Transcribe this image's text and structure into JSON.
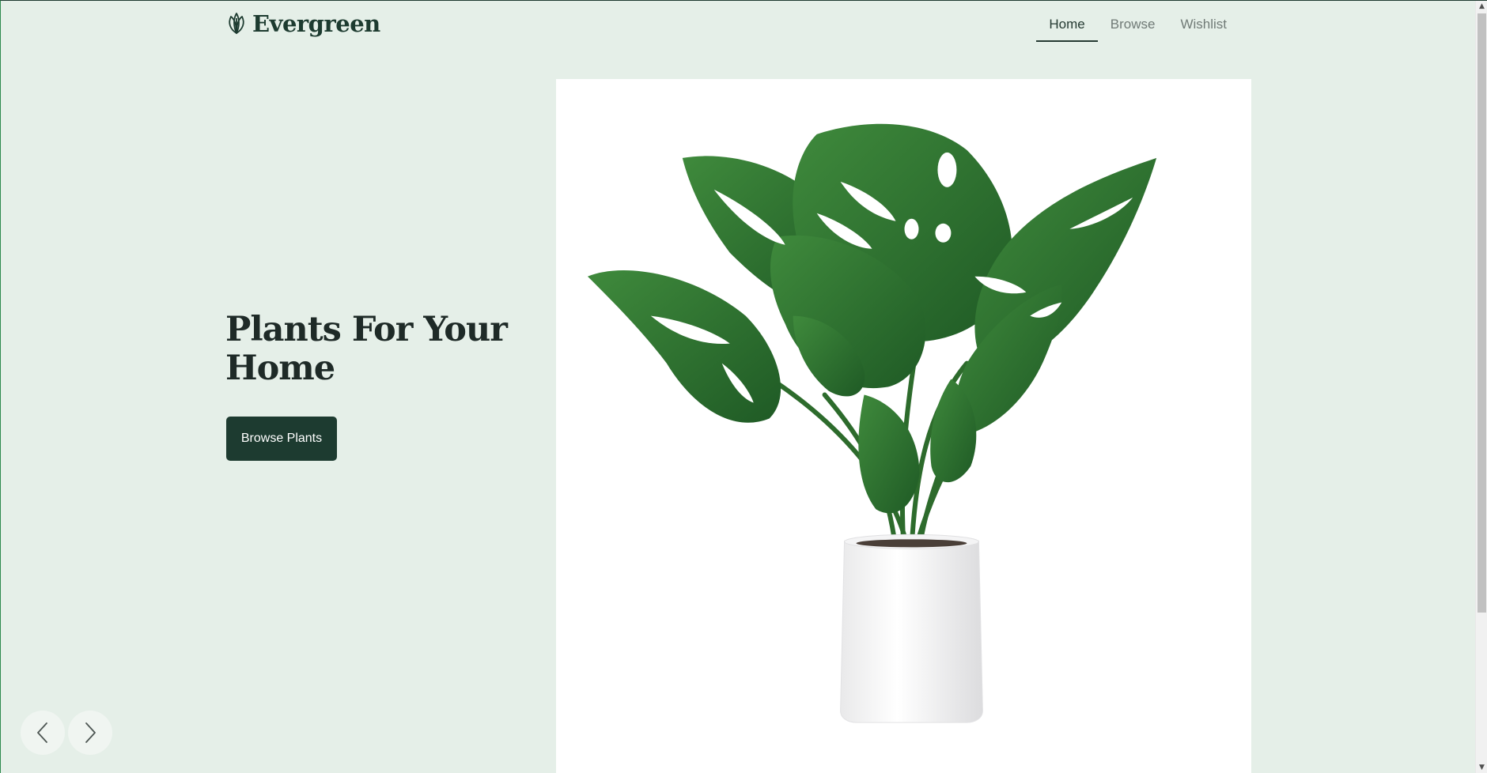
{
  "brand": {
    "name": "Evergreen",
    "logo_icon": "leaf-icon"
  },
  "nav": {
    "items": [
      {
        "label": "Home",
        "active": true
      },
      {
        "label": "Browse",
        "active": false
      },
      {
        "label": "Wishlist",
        "active": false
      }
    ]
  },
  "hero": {
    "title": "Plants For Your Home",
    "cta_label": "Browse Plants",
    "image_subject": "monstera plant in white pot"
  },
  "carousel": {
    "prev_icon": "chevron-left-icon",
    "next_icon": "chevron-right-icon"
  },
  "colors": {
    "background": "#e5efe8",
    "brand": "#1d3b30",
    "nav_inactive": "#707a76",
    "title": "#1e2a27"
  }
}
